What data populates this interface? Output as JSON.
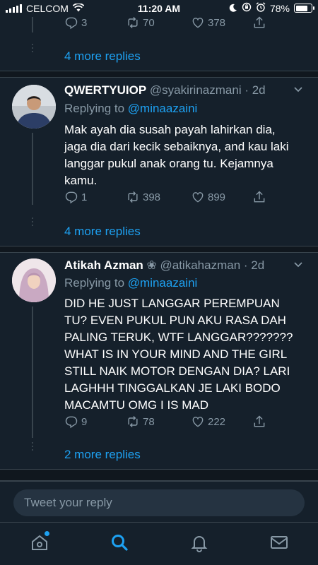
{
  "status_bar": {
    "carrier": "CELCOM",
    "time": "11:20 AM",
    "battery": "78%",
    "battery_level": 0.78
  },
  "top_actions": {
    "replies": "3",
    "retweets": "70",
    "likes": "378"
  },
  "more_replies_1": "4 more replies",
  "tweets": [
    {
      "name": "QWERTYUIOP",
      "handle": "@syakirinazmani · 2d",
      "replying_label": "Replying to ",
      "replying_to": "@minaazaini",
      "text_lines": [
        "Mak ayah dia susah payah lahirkan dia,",
        "jaga dia dari kecik sebaiknya, and kau laki",
        "langgar pukul anak orang tu. Kejamnya",
        "kamu."
      ],
      "replies": "1",
      "retweets": "398",
      "likes": "899",
      "more_replies": "4 more replies"
    },
    {
      "name": "Atikah Azman",
      "name_badge": "❀",
      "handle": "@atikahazman · 2d",
      "replying_label": "Replying to ",
      "replying_to": "@minaazaini",
      "text_lines": [
        "DID HE JUST LANGGAR PEREMPUAN",
        "TU? EVEN PUKUL PUN AKU RASA DAH",
        "PALING TERUK, WTF LANGGAR???????",
        "WHAT IS IN YOUR MIND AND THE GIRL",
        "STILL NAIK MOTOR DENGAN DIA? LARI",
        "LAGHHH TINGGALKAN JE LAKI BODO",
        "MACAMTU OMG   I IS MAD"
      ],
      "replies": "9",
      "retweets": "78",
      "likes": "222",
      "more_replies": "2 more replies"
    }
  ],
  "composer": {
    "placeholder": "Tweet your reply"
  },
  "tabbar": {
    "items": [
      "home-icon",
      "search-icon",
      "notifications-icon",
      "messages-icon"
    ],
    "active": "search"
  },
  "colors": {
    "background": "#15202b",
    "accent": "#1da1f2",
    "muted": "#8899a6",
    "border": "#38444d"
  }
}
